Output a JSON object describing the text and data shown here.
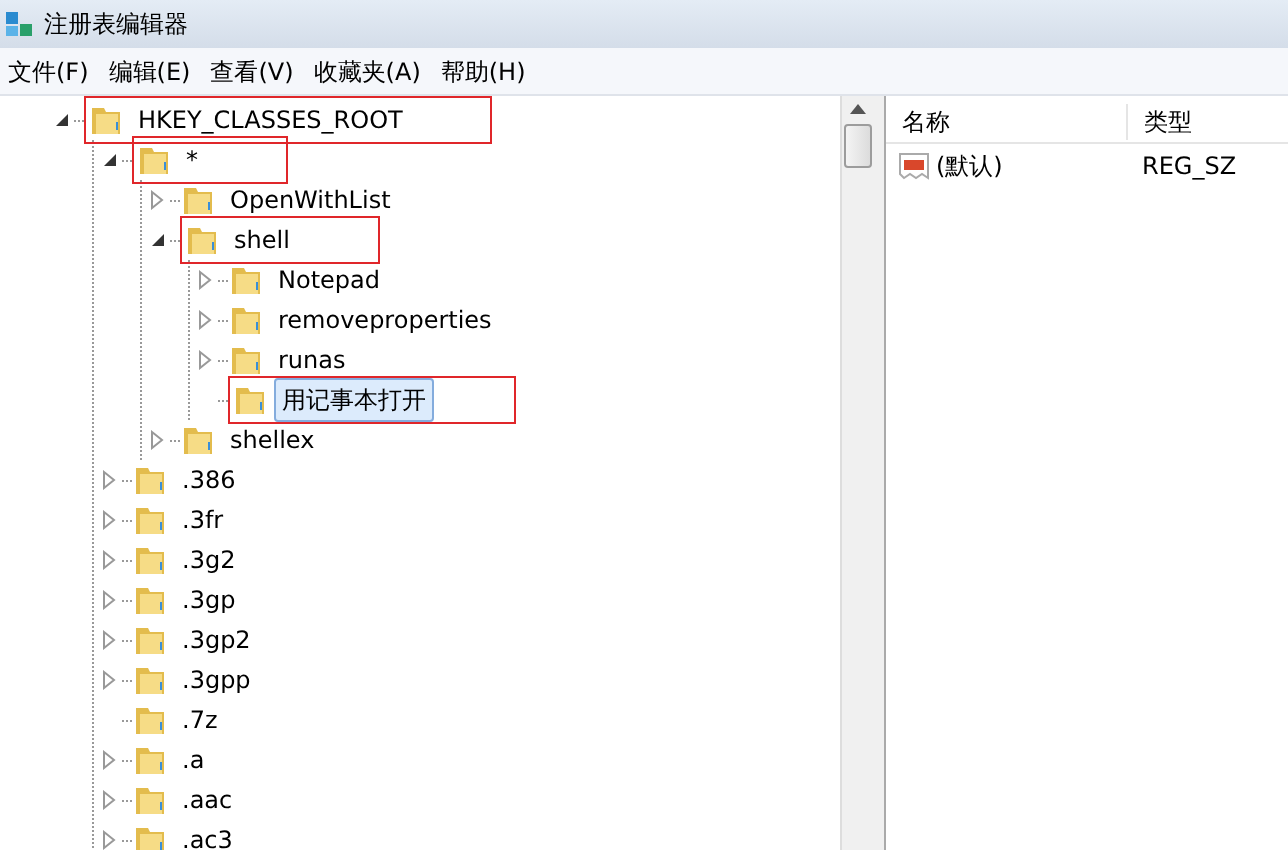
{
  "window": {
    "title": "注册表编辑器"
  },
  "menu": [
    "文件(F)",
    "编辑(E)",
    "查看(V)",
    "收藏夹(A)",
    "帮助(H)"
  ],
  "tree": [
    {
      "label": "HKEY_CLASSES_ROOT",
      "expanded": true,
      "marked": true,
      "children": [
        {
          "label": "*",
          "expanded": true,
          "marked": true,
          "children": [
            {
              "label": "OpenWithList",
              "expanded": false
            },
            {
              "label": "shell",
              "expanded": true,
              "marked": true,
              "children": [
                {
                  "label": "Notepad",
                  "expanded": false
                },
                {
                  "label": "removeproperties",
                  "expanded": false
                },
                {
                  "label": "runas",
                  "expanded": false
                },
                {
                  "label": "用记事本打开",
                  "selected": true,
                  "marked": true
                }
              ]
            },
            {
              "label": "shellex",
              "expanded": false
            }
          ]
        },
        {
          "label": ".386",
          "expanded": false
        },
        {
          "label": ".3fr",
          "expanded": false
        },
        {
          "label": ".3g2",
          "expanded": false
        },
        {
          "label": ".3gp",
          "expanded": false
        },
        {
          "label": ".3gp2",
          "expanded": false
        },
        {
          "label": ".3gpp",
          "expanded": false
        },
        {
          "label": ".7z"
        },
        {
          "label": ".a",
          "expanded": false
        },
        {
          "label": ".aac",
          "expanded": false
        },
        {
          "label": ".ac3",
          "expanded": false
        }
      ]
    }
  ],
  "values": {
    "columns": [
      "名称",
      "类型"
    ],
    "rows": [
      {
        "name": "(默认)",
        "type": "REG_SZ"
      }
    ]
  }
}
